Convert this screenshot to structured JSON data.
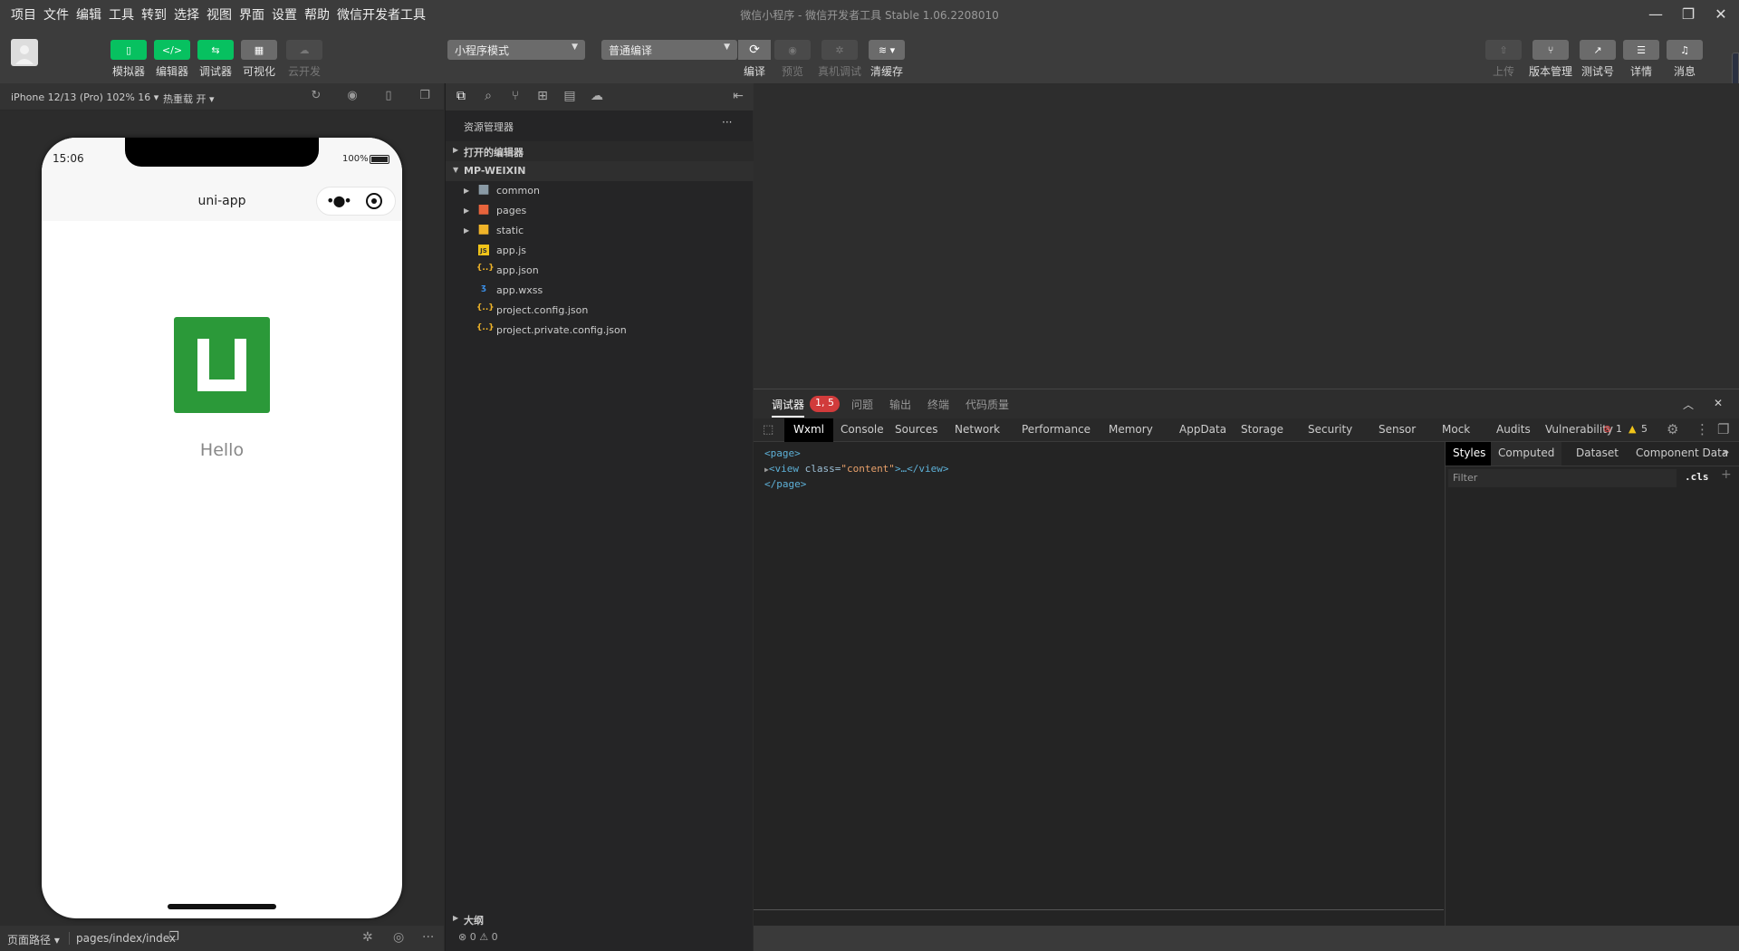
{
  "menu": [
    "项目",
    "文件",
    "编辑",
    "工具",
    "转到",
    "选择",
    "视图",
    "界面",
    "设置",
    "帮助",
    "微信开发者工具"
  ],
  "window_title": "微信小程序 - 微信开发者工具 Stable 1.06.2208010",
  "toolbar": {
    "left_buttons": [
      {
        "label": "模拟器",
        "icon": "phone-icon"
      },
      {
        "label": "编辑器",
        "icon": "code-icon"
      },
      {
        "label": "调试器",
        "icon": "sliders-icon"
      },
      {
        "label": "可视化",
        "icon": "layout-icon"
      },
      {
        "label": "云开发",
        "icon": "cloud-icon"
      }
    ],
    "mode_select": "小程序模式",
    "compile_select": "普通编译",
    "compile_actions": [
      {
        "label": "编译",
        "icon": "refresh-icon"
      },
      {
        "label": "预览",
        "icon": "eye-icon"
      },
      {
        "label": "真机调试",
        "icon": "bug-icon"
      },
      {
        "label": "清缓存",
        "icon": "layers-icon"
      }
    ],
    "right_buttons": [
      {
        "label": "上传",
        "icon": "upload-icon"
      },
      {
        "label": "版本管理",
        "icon": "branch-icon"
      },
      {
        "label": "测试号",
        "icon": "external-link-icon"
      },
      {
        "label": "详情",
        "icon": "menu-icon"
      },
      {
        "label": "消息",
        "icon": "bell-icon"
      }
    ]
  },
  "simulator": {
    "device": "iPhone 12/13 (Pro) 102% 16 ▾",
    "hot_reload": "热重载 开 ▾",
    "time": "15:06",
    "battery": "100%",
    "nav_title": "uni-app",
    "hello": "Hello",
    "path_label": "页面路径 ▾",
    "path": "pages/index/index"
  },
  "explorer": {
    "title": "资源管理器",
    "more": "···",
    "open_editors": "打开的编辑器",
    "project": "MP-WEIXIN",
    "files": [
      {
        "name": "common",
        "type": "folder",
        "icon": "folder-icon",
        "color": "#8a9aa5"
      },
      {
        "name": "pages",
        "type": "folder",
        "icon": "folder-pages-icon",
        "color": "#e8643c"
      },
      {
        "name": "static",
        "type": "folder",
        "icon": "folder-static-icon",
        "color": "#f0b429"
      },
      {
        "name": "app.js",
        "type": "file",
        "icon": "js-file-icon",
        "color": "#f0c419"
      },
      {
        "name": "app.json",
        "type": "file",
        "icon": "json-file-icon",
        "color": "#f0b429"
      },
      {
        "name": "app.wxss",
        "type": "file",
        "icon": "css-file-icon",
        "color": "#3a8ee6"
      },
      {
        "name": "project.config.json",
        "type": "file",
        "icon": "json-file-icon",
        "color": "#f0b429"
      },
      {
        "name": "project.private.config.json",
        "type": "file",
        "icon": "json-file-icon",
        "color": "#f0b429"
      }
    ],
    "outline": "大纲",
    "problems": "⊗ 0 ⚠ 0"
  },
  "debugger": {
    "tabs": [
      "调试器",
      "问题",
      "输出",
      "终端",
      "代码质量"
    ],
    "badge": "1, 5",
    "devtools_tabs": [
      "Wxml",
      "Console",
      "Sources",
      "Network",
      "Performance",
      "Memory",
      "AppData",
      "Storage",
      "Security",
      "Sensor",
      "Mock",
      "Audits",
      "Vulnerability"
    ],
    "errors": "1",
    "warnings": "5",
    "wxml": {
      "line1": "<page>",
      "line2_tag_open": "<view ",
      "line2_attr": "class=",
      "line2_val": "\"content\"",
      "line2_rest": ">…</view>",
      "line3": "</page>"
    },
    "styles_tabs": [
      "Styles",
      "Computed",
      "Dataset",
      "Component Data"
    ],
    "filter_placeholder": "Filter",
    "cls": ".cls",
    "plus": "+"
  },
  "colors": {
    "accent_green": "#07c160",
    "logo_green": "#2b9939",
    "error_red": "#d13b3b",
    "warn_yellow": "#f0c419"
  }
}
